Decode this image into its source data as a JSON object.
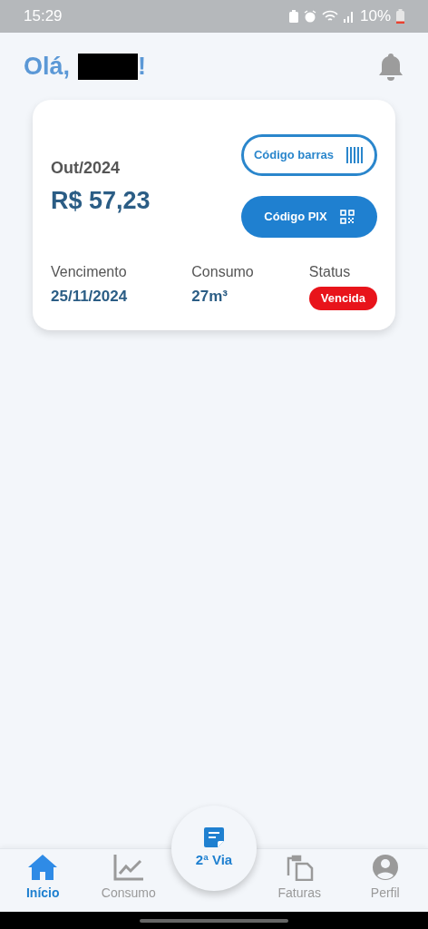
{
  "status_bar": {
    "time": "15:29",
    "battery": "10%"
  },
  "header": {
    "greeting": "Olá,",
    "name_redacted": true,
    "exclamation": "!"
  },
  "bill_card": {
    "period": "Out/2024",
    "amount": "R$ 57,23",
    "buttons": [
      {
        "label": "Código barras",
        "kind": "barcode"
      },
      {
        "label": "Código PIX",
        "kind": "pix"
      }
    ],
    "fields": [
      {
        "label": "Vencimento",
        "value": "25/11/2024",
        "kind": "text"
      },
      {
        "label": "Consumo",
        "value": "27m³",
        "kind": "text"
      },
      {
        "label": "Status",
        "value": "Vencida",
        "kind": "badge",
        "color": "#e8141b"
      }
    ]
  },
  "bottom_nav": [
    {
      "label": "Início",
      "kind": "home",
      "selected": true
    },
    {
      "label": "Consumo",
      "kind": "chart",
      "selected": false
    },
    {
      "label": "2ª Via",
      "kind": "fab",
      "selected": false
    },
    {
      "label": "Faturas",
      "kind": "clipboard",
      "selected": false
    },
    {
      "label": "Perfil",
      "kind": "profile",
      "selected": false
    }
  ]
}
